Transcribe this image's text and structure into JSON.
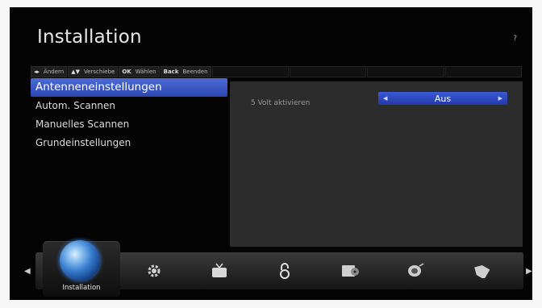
{
  "header": {
    "title": "Installation",
    "help": "?"
  },
  "hints": [
    {
      "key": "◂▸",
      "label": "Ändern"
    },
    {
      "key": "▲▼",
      "label": "Verschiebe"
    },
    {
      "key": "OK",
      "label": "Wählen"
    },
    {
      "key": "Back",
      "label": "Beenden"
    }
  ],
  "menu": {
    "items": [
      {
        "label": "Antenneneinstellungen",
        "selected": true
      },
      {
        "label": "Autom. Scannen",
        "selected": false
      },
      {
        "label": "Manuelles Scannen",
        "selected": false
      },
      {
        "label": "Grundeinstellungen",
        "selected": false
      }
    ]
  },
  "settings": {
    "option_label": "5 Volt aktivieren",
    "option_value": "Aus"
  },
  "dock": {
    "active_label": "Installation",
    "icons": [
      "gear-icon",
      "tv-icon",
      "lock-icon",
      "media-icon",
      "satellite-icon",
      "tag-icon"
    ]
  },
  "colors": {
    "accent": "#2f4fc4",
    "panel": "#2c2c2c"
  }
}
